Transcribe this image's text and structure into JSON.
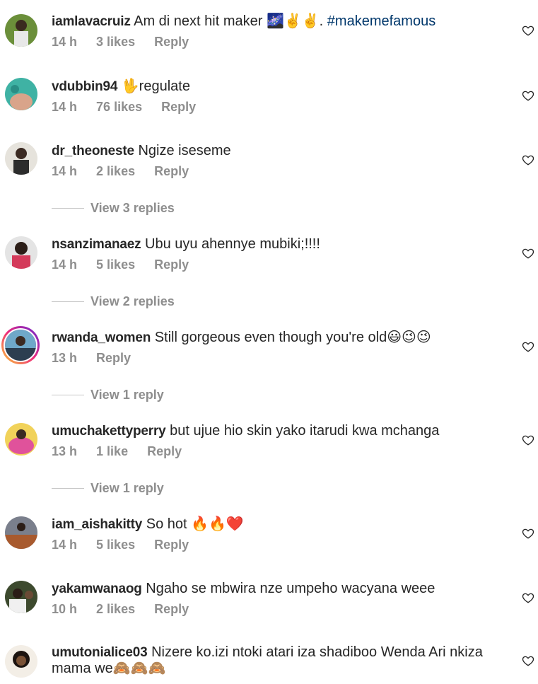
{
  "comments": [
    {
      "username": "iamlavacruiz",
      "text": "Am di next hit maker 🌌✌️✌️. ",
      "hashtag": "#makemefamous",
      "time": "14 h",
      "likes": "3 likes",
      "reply": "Reply"
    },
    {
      "username": "vdubbin94",
      "text": "🖖regulate",
      "time": "14 h",
      "likes": "76 likes",
      "reply": "Reply"
    },
    {
      "username": "dr_theoneste",
      "text": "Ngize iseseme",
      "time": "14 h",
      "likes": "2 likes",
      "reply": "Reply",
      "view_replies": "View 3 replies"
    },
    {
      "username": "nsanzimanaez",
      "text": "Ubu uyu ahennye mubiki;!!!!",
      "time": "14 h",
      "likes": "5 likes",
      "reply": "Reply",
      "view_replies": "View 2 replies"
    },
    {
      "username": "rwanda_women",
      "text": "Still gorgeous even though you're old😃😉😉",
      "time": "13 h",
      "likes": "",
      "reply": "Reply",
      "view_replies": "View 1 reply"
    },
    {
      "username": "umuchakettyperry",
      "text": "but ujue hio skin yako itarudi kwa mchanga",
      "time": "13 h",
      "likes": "1 like",
      "reply": "Reply",
      "view_replies": "View 1 reply"
    },
    {
      "username": "iam_aishakitty",
      "text": "So hot 🔥🔥❤️",
      "time": "14 h",
      "likes": "5 likes",
      "reply": "Reply"
    },
    {
      "username": "yakamwanaog",
      "text": "Ngaho se mbwira nze umpeho wacyana weee",
      "time": "10 h",
      "likes": "2 likes",
      "reply": "Reply"
    },
    {
      "username": "umutonialice03",
      "text": "Nizere ko.izi ntoki atari iza shadiboo Wenda Ari nkiza mama we🙈🙈🙈",
      "time": "",
      "likes": "",
      "reply": ""
    }
  ],
  "icons": {
    "like": "heart-outline-icon"
  },
  "colors": {
    "meta": "#8e8e8e",
    "hashtag": "#00376b",
    "text": "#262626"
  }
}
